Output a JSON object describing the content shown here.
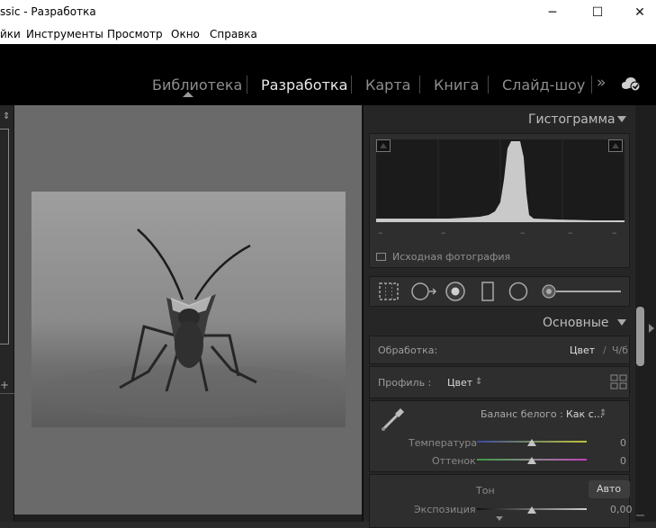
{
  "window": {
    "title": "ssic - Разработка",
    "minimize_icon": "─",
    "maximize_icon": "☐",
    "close_icon": "✕"
  },
  "menu": {
    "items": [
      "йки",
      "Инструменты",
      "Просмотр",
      "Окно",
      "Справка"
    ]
  },
  "modules": {
    "items": [
      "Библиотека",
      "Разработка",
      "Карта",
      "Книга",
      "Слайд-шоу"
    ],
    "active": "Разработка",
    "more_icon": "»"
  },
  "histogram": {
    "title": "Гистограмма",
    "dashes": [
      "–",
      "–",
      "–",
      "–",
      "–"
    ],
    "original_photo_label": "Исходная фотография"
  },
  "basic": {
    "title": "Основные",
    "treatment_label": "Обработка:",
    "treatment_color": "Цвет",
    "treatment_bw": "Ч/б",
    "treatment_sep": "/",
    "profile_label": "Профиль :",
    "profile_value": "Цвет",
    "profile_arrows": "⇕",
    "wb_label": "Баланс белого :",
    "wb_value": "Как с...",
    "wb_arrows": "⇕",
    "temperature_label": "Температура",
    "temperature_value": "0",
    "temperature_position": 0.5,
    "tint_label": "Оттенок",
    "tint_value": "0",
    "tint_position": 0.5,
    "tone_label": "Тон",
    "auto_label": "Авто",
    "exposure_label": "Экспозиция",
    "exposure_value": "0,00",
    "exposure_position": 0.5
  },
  "left_panel": {
    "top_icon": "⇕",
    "plus_icon": "+"
  }
}
